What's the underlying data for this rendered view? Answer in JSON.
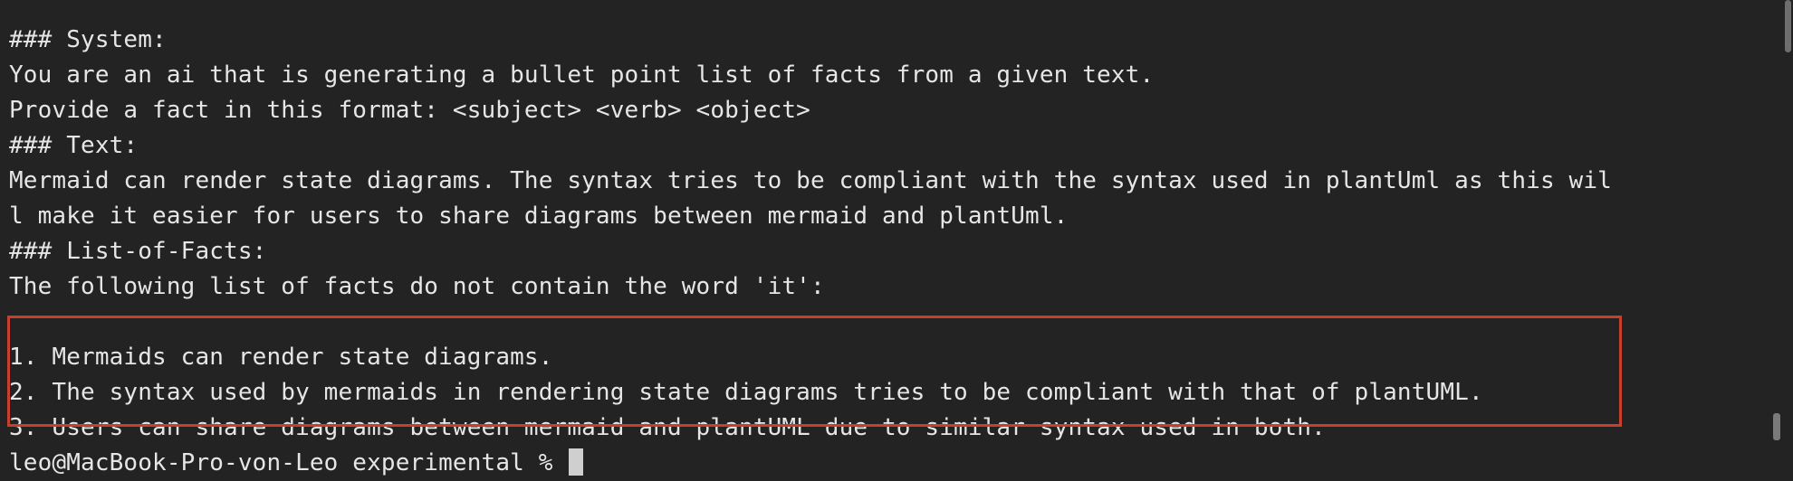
{
  "terminal": {
    "lines": [
      "",
      "### System:",
      "You are an ai that is generating a bullet point list of facts from a given text.",
      "Provide a fact in this format: <subject> <verb> <object>",
      "### Text:",
      "Mermaid can render state diagrams. The syntax tries to be compliant with the syntax used in plantUml as this wil",
      "l make it easier for users to share diagrams between mermaid and plantUml.",
      "### List-of-Facts:",
      "The following list of facts do not contain the word 'it':",
      "",
      "1. Mermaids can render state diagrams.",
      "2. The syntax used by mermaids in rendering state diagrams tries to be compliant with that of plantUML.",
      "3. Users can share diagrams between mermaid and plantUML due to similar syntax used in both."
    ],
    "prompt": "leo@MacBook-Pro-von-Leo experimental % "
  },
  "colors": {
    "background": "#232323",
    "text": "#e6e6e6",
    "highlight_border": "#c8402c",
    "cursor": "#cfcfcf"
  }
}
